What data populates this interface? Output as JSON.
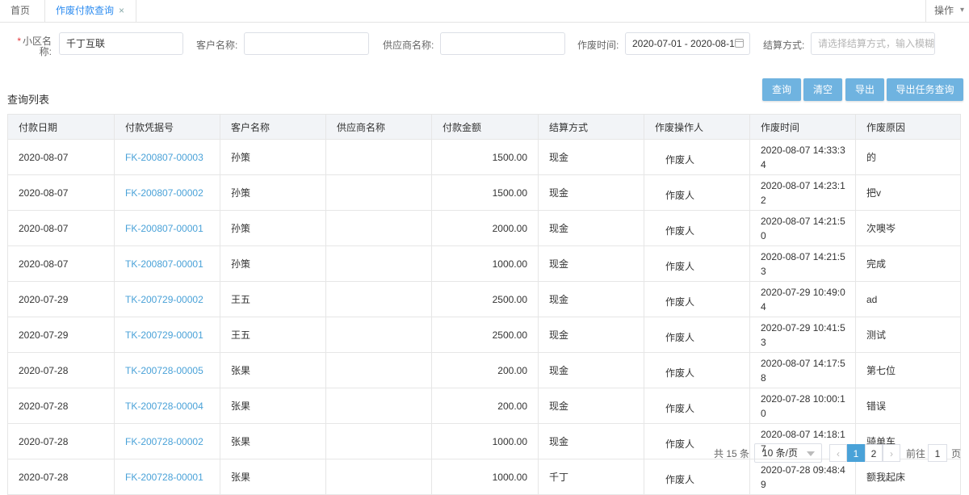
{
  "tabs": {
    "home": "首页",
    "active": "作废付款查询",
    "close": "×",
    "ops": "操作"
  },
  "filters": {
    "community_label": "小区名称:",
    "community_label_a": "小区名",
    "community_label_b": "称:",
    "community_value": "千丁互联",
    "customer_label": "客户名称:",
    "customer_value": "",
    "supplier_label": "供应商名称:",
    "supplier_value": "",
    "void_time_label": "作废时间:",
    "void_time_value": "2020-07-01 - 2020-08-1",
    "settle_label": "结算方式:",
    "settle_placeholder": "请选择结算方式，输入模糊"
  },
  "buttons": {
    "query": "查询",
    "clear": "清空",
    "export": "导出",
    "export_task": "导出任务查询"
  },
  "list_title": "查询列表",
  "table": {
    "headers": [
      "付款日期",
      "付款凭据号",
      "客户名称",
      "供应商名称",
      "付款金额",
      "结算方式",
      "作废操作人",
      "作废时间",
      "作废原因"
    ],
    "rows": [
      [
        "2020-08-07",
        "FK-200807-00003",
        "孙策",
        "",
        "1500.00",
        "现金",
        "作废人",
        "2020-08-07 14:33:34",
        "的"
      ],
      [
        "2020-08-07",
        "FK-200807-00002",
        "孙策",
        "",
        "1500.00",
        "现金",
        "作废人",
        "2020-08-07 14:23:12",
        "把v"
      ],
      [
        "2020-08-07",
        "FK-200807-00001",
        "孙策",
        "",
        "2000.00",
        "现金",
        "作废人",
        "2020-08-07 14:21:50",
        "次噢岑"
      ],
      [
        "2020-08-07",
        "TK-200807-00001",
        "孙策",
        "",
        "1000.00",
        "现金",
        "作废人",
        "2020-08-07 14:21:53",
        "完成"
      ],
      [
        "2020-07-29",
        "TK-200729-00002",
        "王五",
        "",
        "2500.00",
        "现金",
        "作废人",
        "2020-07-29 10:49:04",
        "ad"
      ],
      [
        "2020-07-29",
        "TK-200729-00001",
        "王五",
        "",
        "2500.00",
        "现金",
        "作废人",
        "2020-07-29 10:41:53",
        "测试"
      ],
      [
        "2020-07-28",
        "TK-200728-00005",
        "张果",
        "",
        "200.00",
        "现金",
        "作废人",
        "2020-08-07 14:17:58",
        "第七位"
      ],
      [
        "2020-07-28",
        "TK-200728-00004",
        "张果",
        "",
        "200.00",
        "现金",
        "作废人",
        "2020-07-28 10:00:10",
        "错误"
      ],
      [
        "2020-07-28",
        "FK-200728-00002",
        "张果",
        "",
        "1000.00",
        "现金",
        "作废人",
        "2020-08-07 14:18:17",
        "骑单车"
      ],
      [
        "2020-07-28",
        "FK-200728-00001",
        "张果",
        "",
        "1000.00",
        "千丁",
        "作废人",
        "2020-07-28 09:48:49",
        "额我起床"
      ]
    ]
  },
  "pagination": {
    "total": "共 15 条",
    "page_size": "10 条/页",
    "prev": "‹",
    "next": "›",
    "pages": [
      "1",
      "2"
    ],
    "goto_prefix": "前往",
    "goto_value": "1",
    "goto_suffix": "页"
  },
  "colors": {
    "accent": "#4aa2d8",
    "button": "#6fb3e0",
    "required": "#e4393c",
    "header_bg": "#f2f4f7"
  }
}
